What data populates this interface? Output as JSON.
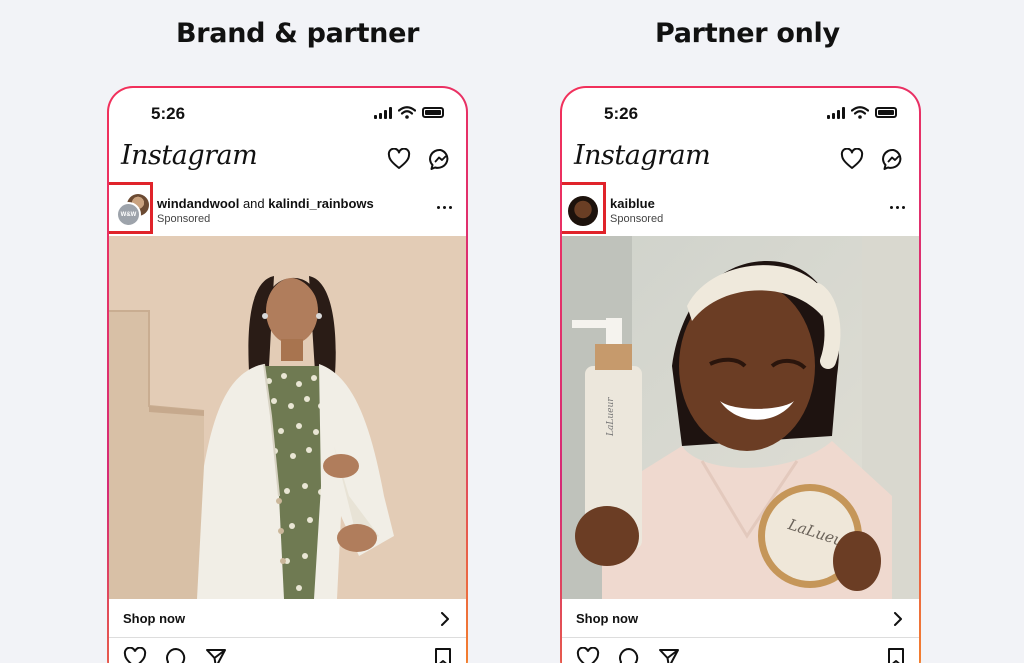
{
  "headings": {
    "left": "Brand & partner",
    "right": "Partner only"
  },
  "phones": {
    "left": {
      "time": "5:26",
      "app_name": "Instagram",
      "brand_user": "windandwool",
      "joiner": "and",
      "partner_user": "kalindi_rainbows",
      "sponsored": "Sponsored",
      "avatar_text": "W&W",
      "shop_now": "Shop now"
    },
    "right": {
      "time": "5:26",
      "app_name": "Instagram",
      "user": "kaiblue",
      "sponsored": "Sponsored",
      "product_label_bottle": "LaLueur",
      "product_label_jar": "LaLueur",
      "shop_now": "Shop now"
    }
  },
  "colors": {
    "highlight_box": "#e0232a",
    "frame_gradient": [
      "#f2305a",
      "#d62976",
      "#f58529"
    ]
  },
  "icons": [
    "signal-icon",
    "wifi-icon",
    "battery-icon",
    "heart-icon",
    "messenger-icon",
    "more-icon",
    "chevron-right-icon",
    "comment-icon",
    "share-icon",
    "save-icon"
  ]
}
